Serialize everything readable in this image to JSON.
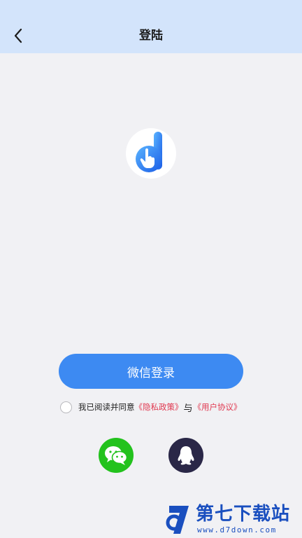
{
  "header": {
    "title": "登陆",
    "back_icon": "chevron-left-icon"
  },
  "logo": {
    "icon": "app-logo-d-icon",
    "gradient": [
      "#5ab4ff",
      "#1a5ce6"
    ]
  },
  "login": {
    "wechat_button_label": "微信登录"
  },
  "agreement": {
    "prefix": "我已阅读并同意",
    "privacy_link": "《隐私政策》",
    "and": "与",
    "user_agreement_link": "《用户协议》",
    "checked": false
  },
  "social": {
    "wechat_icon": "wechat-icon",
    "qq_icon": "qq-icon"
  },
  "watermark": {
    "name": "第七下载站",
    "url": "www.d7down.com"
  },
  "colors": {
    "header_bg": "#d3e4fb",
    "page_bg": "#f1f1f4",
    "primary": "#3d8af2",
    "link": "#e0384f",
    "wechat": "#23c21d",
    "qq": "#2a2747"
  }
}
